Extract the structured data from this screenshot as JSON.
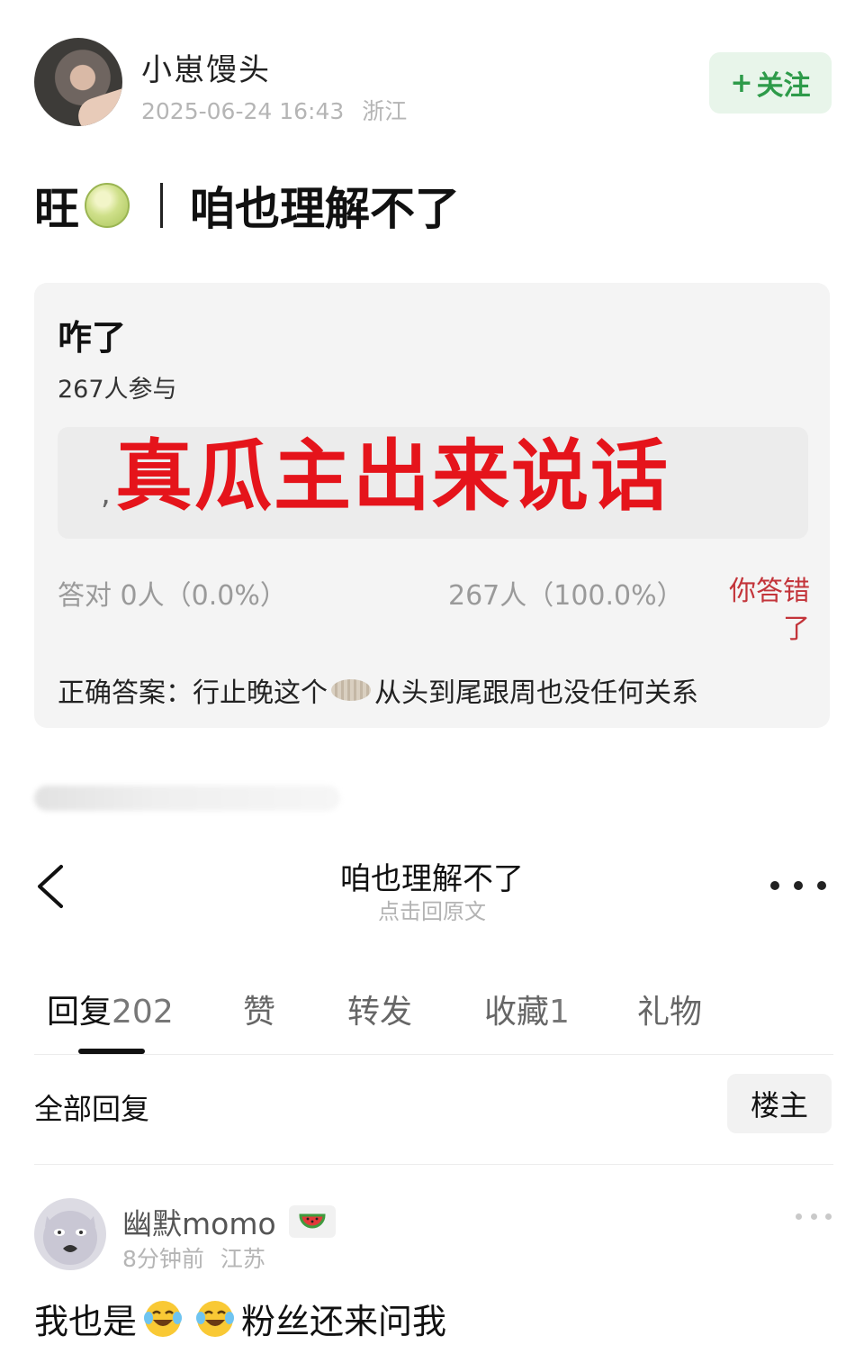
{
  "post": {
    "author": "小崽馒头",
    "timestamp": "2025-06-24 16:43",
    "location": "浙江",
    "follow_plus": "+",
    "follow_label": "关注",
    "title_prefix": "旺",
    "title_icon": "melon-icon",
    "title_text": "咱也理解不了"
  },
  "quiz": {
    "question": "咋了",
    "participants": "267人参与",
    "option_marker": ",",
    "overlay_text": "真瓜主出来说话",
    "overlay_color": "#e5141b",
    "correct_stats": "答对  0人（0.0%）",
    "wrong_stats": "267人（100.0%）",
    "wrong_label": "你答错了",
    "answer_prefix": "正确答案：行止晚这个",
    "answer_icon": "dumpling-icon",
    "answer_suffix": "从头到尾跟周也没任何关系"
  },
  "nav": {
    "back_icon": "chevron-left-icon",
    "title": "咱也理解不了",
    "subtitle": "点击回原文",
    "more_icon": "more-horizontal-icon"
  },
  "tabs": [
    {
      "label": "回复",
      "count": "202"
    },
    {
      "label": "赞",
      "count": ""
    },
    {
      "label": "转发",
      "count": ""
    },
    {
      "label": "收藏",
      "count": "1"
    },
    {
      "label": "礼物",
      "count": ""
    }
  ],
  "replies_header": {
    "all_label": "全部回复",
    "op_filter": "楼主"
  },
  "reply": {
    "user": "幽默momo",
    "badge_icon": "watermelon-icon",
    "time": "8分钟前",
    "location": "江苏",
    "text_prefix": "我也是",
    "emoji": "laughing-tears-emoji",
    "text_suffix": "粉丝还来问我"
  },
  "colors": {
    "accent_green": "#2e9b4a",
    "follow_bg": "#e8f5ea",
    "wrong_red": "#c3343a"
  }
}
